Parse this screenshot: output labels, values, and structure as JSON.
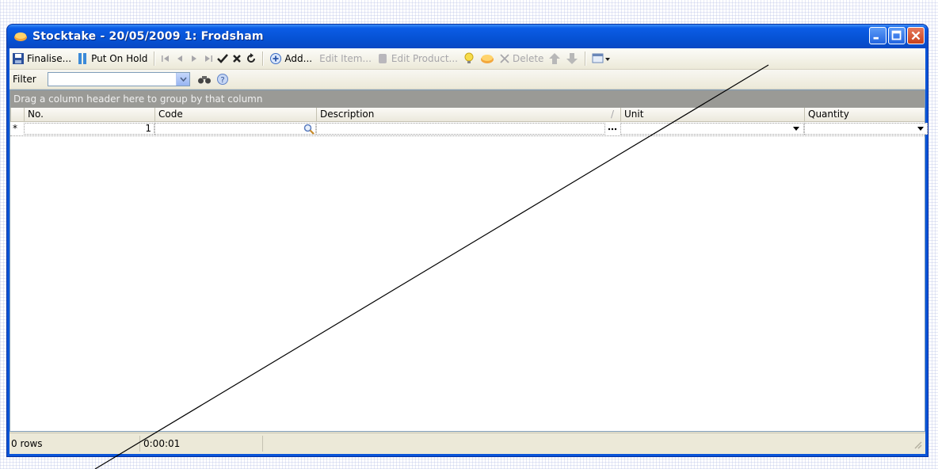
{
  "window": {
    "title": "Stocktake - 20/05/2009 1: Frodsham"
  },
  "toolbar": {
    "finalise": "Finalise...",
    "put_on_hold": "Put On Hold",
    "add": "Add...",
    "edit_item": "Edit Item...",
    "edit_product": "Edit Product...",
    "delete": "Delete"
  },
  "filter": {
    "label": "Filter",
    "value": ""
  },
  "grid": {
    "group_panel_text": "Drag a column header here to group by that column",
    "columns": [
      "No.",
      "Code",
      "Description",
      "Unit",
      "Quantity"
    ],
    "sort_indicator": "/",
    "new_row": {
      "indicator": "*",
      "no": "1",
      "code": "",
      "description": "",
      "unit": "",
      "quantity": ""
    }
  },
  "status": {
    "rows": "0 rows",
    "time": "0:00:01"
  },
  "colors": {
    "title_bar": "#0652d4",
    "client_bg": "#ece9d8",
    "group_panel": "#9a9a96"
  }
}
